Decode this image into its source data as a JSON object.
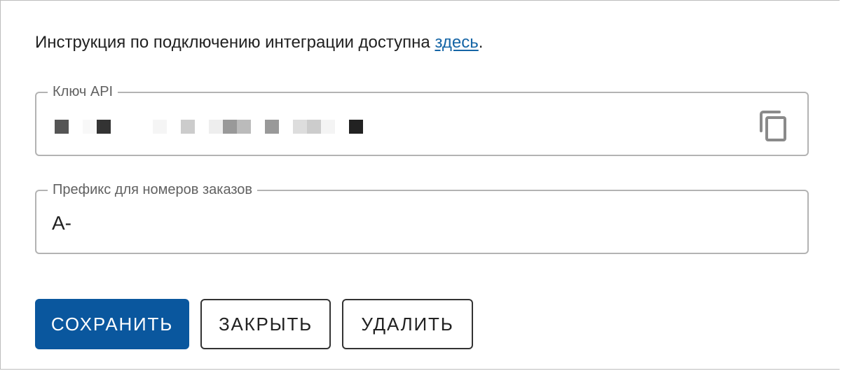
{
  "intro": {
    "text": "Инструкция по подключению интеграции доступна ",
    "link_label": "здесь",
    "suffix": "."
  },
  "api_key_field": {
    "label": "Ключ API",
    "masked_value_shades": [
      "#555555",
      "#ffffff",
      "#f8f8f8",
      "#333333",
      "#ffffff",
      "#ffffff",
      "#ffffff",
      "#f5f5f5",
      "#ffffff",
      "#cccccc",
      "#ffffff",
      "#eeeeee",
      "#999999",
      "#bbbbbb",
      "#ffffff",
      "#999999",
      "#ffffff",
      "#dddddd",
      "#cccccc",
      "#f4f4f4",
      "#ffffff",
      "#222222"
    ],
    "copy_icon": "copy-icon"
  },
  "prefix_field": {
    "label": "Префикс для номеров заказов",
    "value": "A-"
  },
  "buttons": {
    "save": "СОХРАНИТЬ",
    "close": "ЗАКРЫТЬ",
    "delete": "УДАЛИТЬ"
  },
  "colors": {
    "primary": "#0a579e",
    "link": "#1565a6",
    "border": "#b3b3b3"
  }
}
